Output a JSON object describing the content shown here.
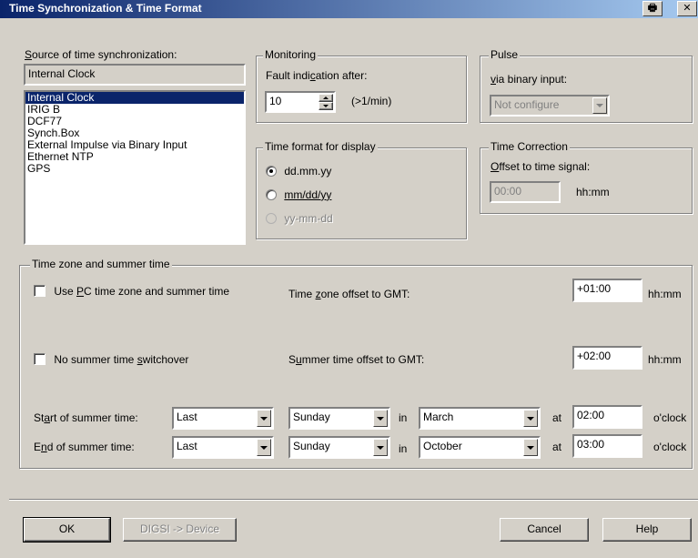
{
  "window": {
    "title": "Time Synchronization & Time Format",
    "print_icon": "printer-icon",
    "close_icon": "close-icon",
    "print_glyph": "🖶",
    "close_glyph": "✕"
  },
  "source": {
    "label": "Source of time synchronization:",
    "current": "Internal Clock",
    "items": [
      "Internal Clock",
      "IRIG B",
      "DCF77",
      "Synch.Box",
      "External Impulse via Binary Input",
      "Ethernet NTP",
      "GPS"
    ],
    "selected_index": 0
  },
  "monitoring": {
    "group_label": "Monitoring",
    "fault_label": "Fault indication after:",
    "value": "10",
    "unit": "(>1/min)"
  },
  "pulse": {
    "group_label": "Pulse",
    "via_label": "via binary input:",
    "value": "Not configure"
  },
  "time_format": {
    "group_label": "Time format for display",
    "options": [
      "dd.mm.yy",
      "mm/dd/yy",
      "yy-mm-dd"
    ],
    "selected": "dd.mm.yy"
  },
  "time_correction": {
    "group_label": "Time Correction",
    "offset_label": "Offset to time signal:",
    "value": "00:00",
    "unit": "hh:mm"
  },
  "timezone": {
    "group_label": "Time zone and summer time",
    "use_pc_label": "Use PC time zone and summer time",
    "use_pc_checked": false,
    "tz_offset_label": "Time zone offset to GMT:",
    "tz_offset_value": "+01:00",
    "tz_offset_unit": "hh:mm",
    "no_summer_label": "No summer time switchover",
    "no_summer_checked": false,
    "summer_offset_label": "Summer time offset to GMT:",
    "summer_offset_value": "+02:00",
    "summer_offset_unit": "hh:mm",
    "start": {
      "label": "Start of summer time:",
      "week": "Last",
      "day": "Sunday",
      "in": "in",
      "month": "March",
      "at": "at",
      "time": "02:00",
      "unit": "o'clock"
    },
    "end": {
      "label": "End of summer time:",
      "week": "Last",
      "day": "Sunday",
      "in": "in",
      "month": "October",
      "at": "at",
      "time": "03:00",
      "unit": "o'clock"
    }
  },
  "buttons": {
    "ok": "OK",
    "digsi": "DIGSI -> Device",
    "cancel": "Cancel",
    "help": "Help"
  }
}
